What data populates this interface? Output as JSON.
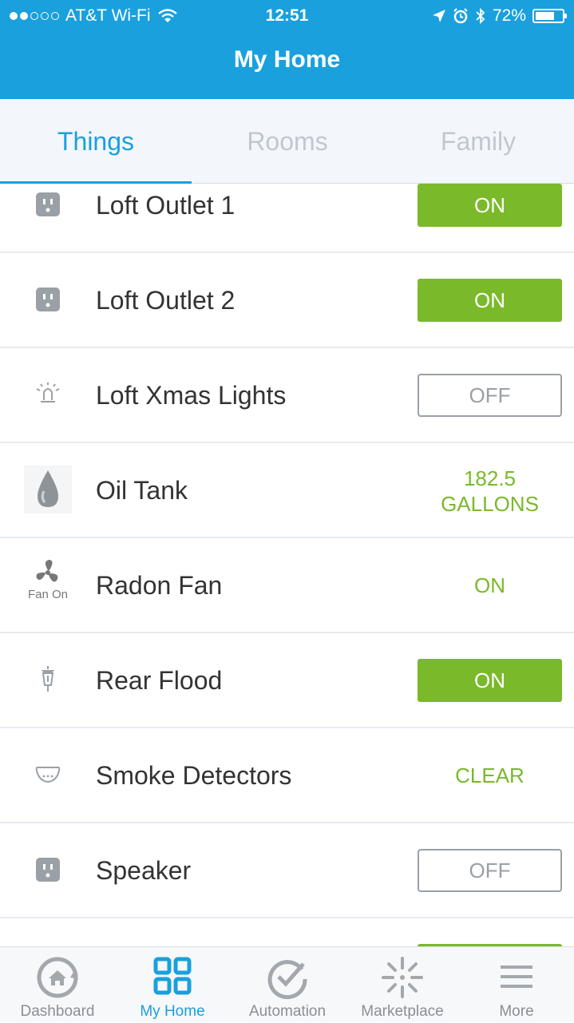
{
  "status_bar": {
    "carrier": "AT&T Wi-Fi",
    "time": "12:51",
    "battery_pct": "72%",
    "battery_fraction": 0.72
  },
  "header": {
    "title": "My Home"
  },
  "tabs": [
    {
      "label": "Things",
      "active": true
    },
    {
      "label": "Rooms",
      "active": false
    },
    {
      "label": "Family",
      "active": false
    }
  ],
  "things": [
    {
      "name": "Loft Outlet 1",
      "icon": "outlet-icon",
      "state": "ON"
    },
    {
      "name": "Loft Outlet 2",
      "icon": "outlet-icon",
      "state": "ON"
    },
    {
      "name": "Loft Xmas Lights",
      "icon": "light-bulb-icon",
      "state": "OFF"
    },
    {
      "name": "Oil Tank",
      "icon": "oil-drop-icon",
      "value_line1": "182.5",
      "value_line2": "GALLONS"
    },
    {
      "name": "Radon Fan",
      "icon": "fan-icon",
      "icon_caption": "Fan On",
      "value": "ON"
    },
    {
      "name": "Rear Flood",
      "icon": "lantern-icon",
      "state": "ON"
    },
    {
      "name": "Smoke Detectors",
      "icon": "smoke-detector-icon",
      "value": "CLEAR"
    },
    {
      "name": "Speaker",
      "icon": "outlet-icon",
      "state": "OFF"
    }
  ],
  "nav": [
    {
      "label": "Dashboard",
      "icon": "dashboard-home-icon",
      "active": false
    },
    {
      "label": "My Home",
      "icon": "grid-icon",
      "active": true
    },
    {
      "label": "Automation",
      "icon": "checkmark-circle-icon",
      "active": false
    },
    {
      "label": "Marketplace",
      "icon": "sparkle-icon",
      "active": false
    },
    {
      "label": "More",
      "icon": "hamburger-menu-icon",
      "active": false
    }
  ],
  "colors": {
    "brand_blue": "#1aa0dc",
    "on_green": "#7ab92a",
    "off_gray": "#9aa0a6"
  }
}
